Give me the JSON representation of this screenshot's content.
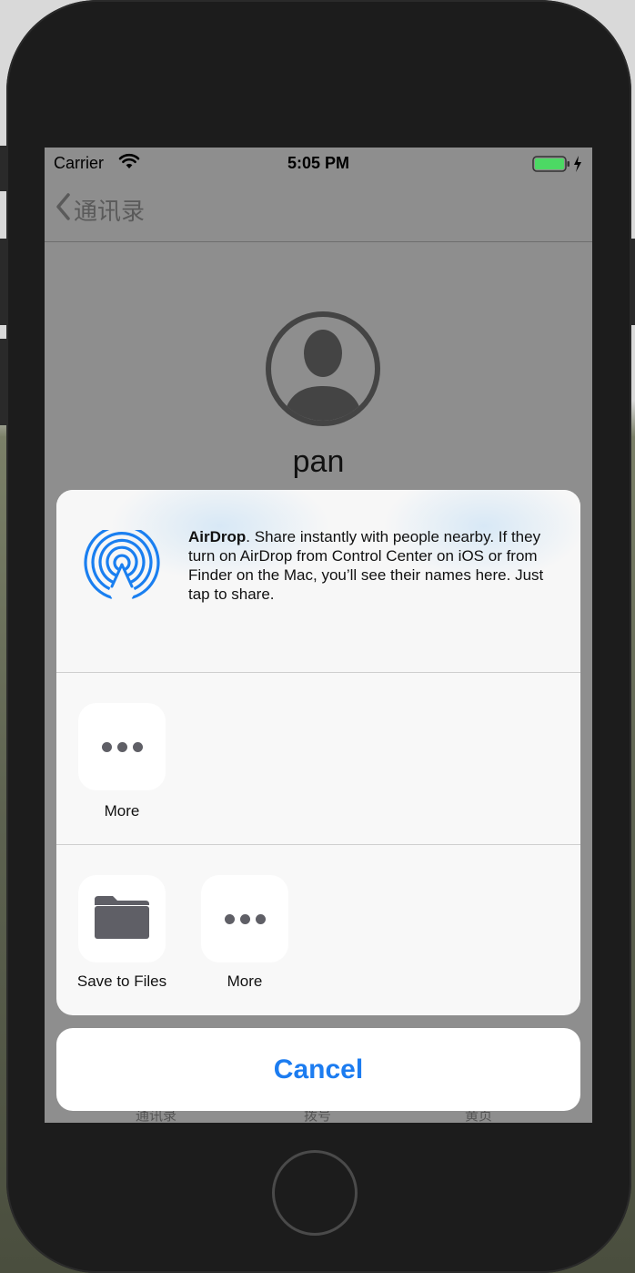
{
  "status_bar": {
    "carrier": "Carrier",
    "time": "5:05 PM"
  },
  "nav": {
    "back_label": "通讯录"
  },
  "profile": {
    "name": "pan"
  },
  "share_sheet": {
    "airdrop_title": "AirDrop",
    "airdrop_description": ". Share instantly with people nearby. If they turn on AirDrop from Control Center on iOS or from Finder on the Mac, you’ll see their names here. Just tap to share.",
    "apps_row": [
      {
        "label": "More",
        "icon": "more-icon"
      }
    ],
    "actions_row": [
      {
        "label": "Save to Files",
        "icon": "folder-icon"
      },
      {
        "label": "More",
        "icon": "more-icon"
      }
    ],
    "cancel_label": "Cancel"
  },
  "tab_bar": {
    "tab1": "通讯录",
    "tab2": "拨号",
    "tab3": "黄页"
  },
  "colors": {
    "accent": "#1c7cf0",
    "airdrop_blue": "#1a7ff0",
    "battery_green": "#4cd964"
  }
}
